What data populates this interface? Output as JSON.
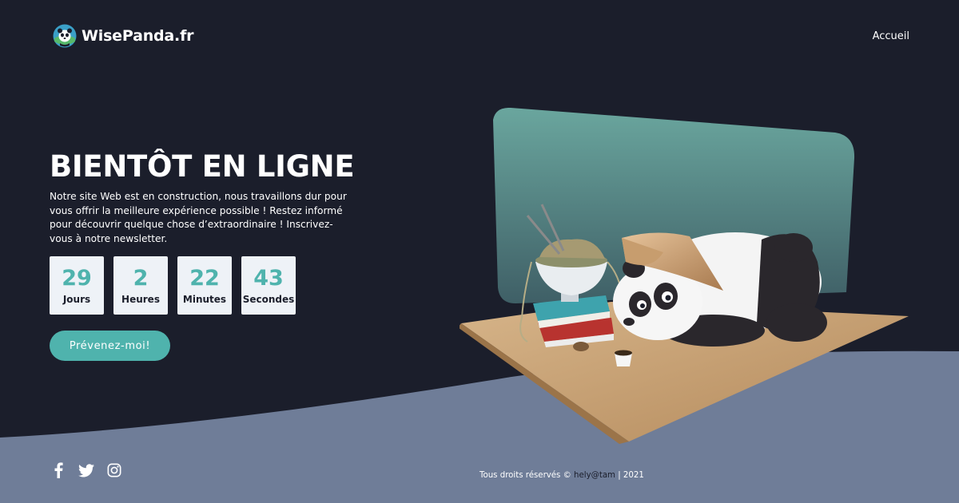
{
  "brand": {
    "name": "WisePanda.fr",
    "logo_icon": "panda-logo-icon"
  },
  "nav": {
    "items": [
      {
        "label": "Accueil"
      }
    ]
  },
  "hero": {
    "title": "BIENTÔT EN LIGNE",
    "description": "Notre site Web est en construction, nous travaillons dur pour vous offrir la meilleure expérience possible ! Restez informé pour découvrir quelque chose d’extraordinaire ! Inscrivez-vous à notre newsletter.",
    "cta_label": "Prévenez-moi!"
  },
  "countdown": [
    {
      "value": "29",
      "label": "Jours"
    },
    {
      "value": "2",
      "label": "Heures"
    },
    {
      "value": "22",
      "label": "Minutes"
    },
    {
      "value": "43",
      "label": "Secondes"
    }
  ],
  "illustration": {
    "subject": "panda-reading-illustration"
  },
  "footer": {
    "social": [
      {
        "icon": "facebook-icon"
      },
      {
        "icon": "twitter-icon"
      },
      {
        "icon": "instagram-icon"
      }
    ],
    "copyright_prefix": "Tous droits réservés ©",
    "copyright_author": "hely@tam",
    "copyright_year": "| 2021"
  },
  "colors": {
    "background": "#1b1e2b",
    "wave": "#6f7d98",
    "accent": "#4fb3ad",
    "box": "#eef2f7"
  }
}
